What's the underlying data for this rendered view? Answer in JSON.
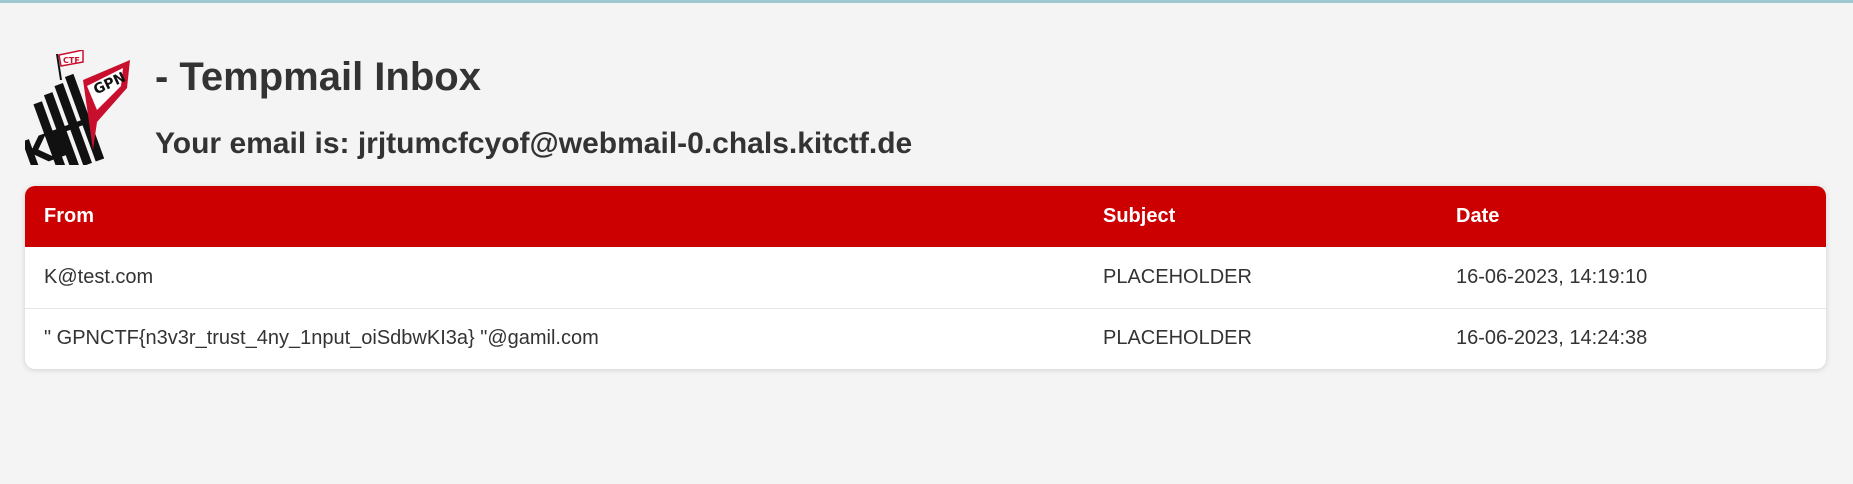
{
  "header": {
    "logo_text": [
      "KIT",
      "GPN",
      "CTF"
    ],
    "title": "- Tempmail Inbox",
    "email_line": "Your email is: jrjtumcfcyof@webmail-0.chals.kitctf.de"
  },
  "colors": {
    "accent": "#cc0000",
    "background": "#f4f4f4",
    "text": "#333333"
  },
  "inbox": {
    "columns": [
      "From",
      "Subject",
      "Date"
    ],
    "rows": [
      {
        "from": "K@test.com",
        "subject": "PLACEHOLDER",
        "date": "16-06-2023, 14:19:10"
      },
      {
        "from": "\" GPNCTF{n3v3r_trust_4ny_1nput_oiSdbwKI3a} \"@gamil.com",
        "subject": "PLACEHOLDER",
        "date": "16-06-2023, 14:24:38"
      }
    ]
  }
}
